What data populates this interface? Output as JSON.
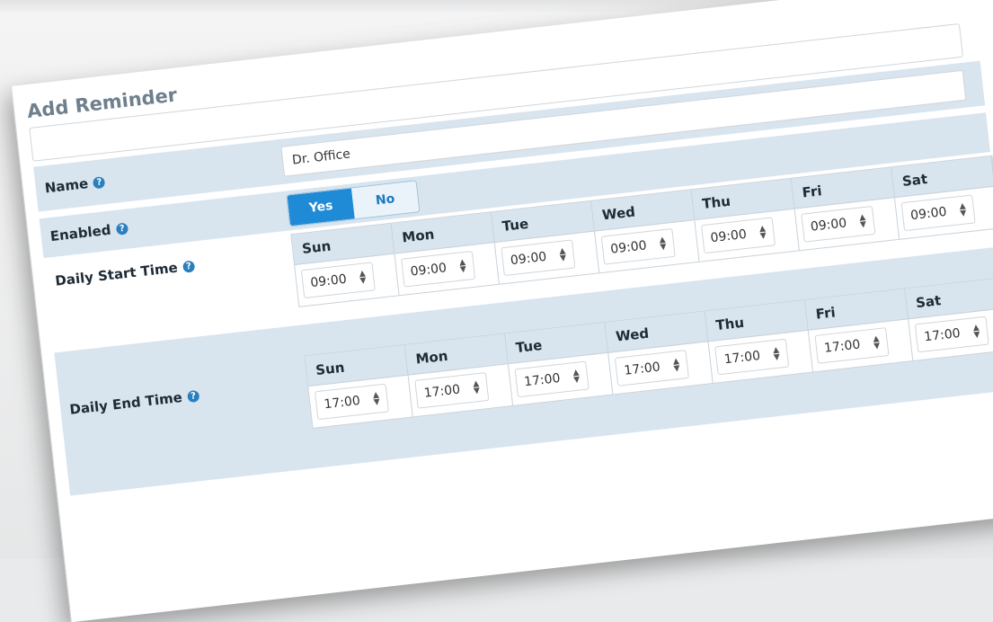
{
  "form": {
    "title": "Add Reminder",
    "name": {
      "label": "Name",
      "value": "Dr. Office"
    },
    "enabled": {
      "label": "Enabled",
      "yes": "Yes",
      "no": "No",
      "selected": "Yes"
    },
    "start": {
      "label": "Daily Start Time",
      "days": [
        {
          "day": "Sun",
          "time": "09:00"
        },
        {
          "day": "Mon",
          "time": "09:00"
        },
        {
          "day": "Tue",
          "time": "09:00"
        },
        {
          "day": "Wed",
          "time": "09:00"
        },
        {
          "day": "Thu",
          "time": "09:00"
        },
        {
          "day": "Fri",
          "time": "09:00"
        },
        {
          "day": "Sat",
          "time": "09:00"
        }
      ]
    },
    "end": {
      "label": "Daily End Time",
      "days": [
        {
          "day": "Sun",
          "time": "17:00"
        },
        {
          "day": "Mon",
          "time": "17:00"
        },
        {
          "day": "Tue",
          "time": "17:00"
        },
        {
          "day": "Wed",
          "time": "17:00"
        },
        {
          "day": "Thu",
          "time": "17:00"
        },
        {
          "day": "Fri",
          "time": "17:00"
        },
        {
          "day": "Sat",
          "time": "17:00"
        }
      ]
    }
  },
  "icons": {
    "help": "help-circle-icon",
    "spinner": "up-down-arrows-icon"
  },
  "colors": {
    "band": "#d8e4ee",
    "accent": "#1f8ad6",
    "title": "#6e7f8d"
  }
}
